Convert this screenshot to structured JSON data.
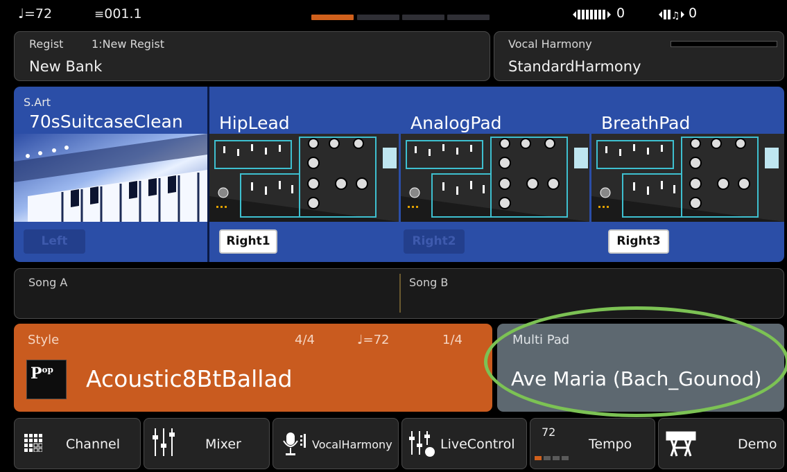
{
  "status": {
    "tempo": "♩=72",
    "bar": "001.1",
    "keyboard_value": "0",
    "transpose_value": "0",
    "page_indicator": {
      "count": 4,
      "active": 1
    }
  },
  "regist": {
    "label": "Regist",
    "current": "1:New Regist",
    "bank": "New Bank"
  },
  "vocal_harmony": {
    "label": "Vocal Harmony",
    "name": "StandardHarmony"
  },
  "voices": [
    {
      "sub": "S.Art",
      "name": "70sSuitcaseClean",
      "part": "Left",
      "active": false
    },
    {
      "sub": "",
      "name": "HipLead",
      "part": "Right1",
      "active": true
    },
    {
      "sub": "",
      "name": "AnalogPad",
      "part": "Right2",
      "active": false
    },
    {
      "sub": "",
      "name": "BreathPad",
      "part": "Right3",
      "active": true
    }
  ],
  "song": {
    "a_label": "Song A",
    "b_label": "Song B"
  },
  "style": {
    "label": "Style",
    "time_sig": "4/4",
    "tempo": "♩=72",
    "position": "1/4",
    "badge": "Pop",
    "name": "Acoustic8BtBallad"
  },
  "multipad": {
    "label": "Multi Pad",
    "name": "Ave Maria (Bach_Gounod)"
  },
  "colors": {
    "accent_orange": "#c95b1f",
    "voice_blue": "#2b4ea7",
    "multipad_gray": "#5d6870",
    "highlight_green": "#7cc254"
  },
  "bottom_buttons": [
    {
      "label": "Channel",
      "icon": "channel-grid-icon"
    },
    {
      "label": "Mixer",
      "icon": "mixer-faders-icon"
    },
    {
      "label": "VocalHarmony",
      "icon": "microphone-icon"
    },
    {
      "label": "LiveControl",
      "icon": "live-control-knob-icon"
    },
    {
      "label": "Tempo",
      "icon": "tempo-meter-icon",
      "value": "72"
    },
    {
      "label": "Demo",
      "icon": "keyboard-stand-icon"
    }
  ]
}
